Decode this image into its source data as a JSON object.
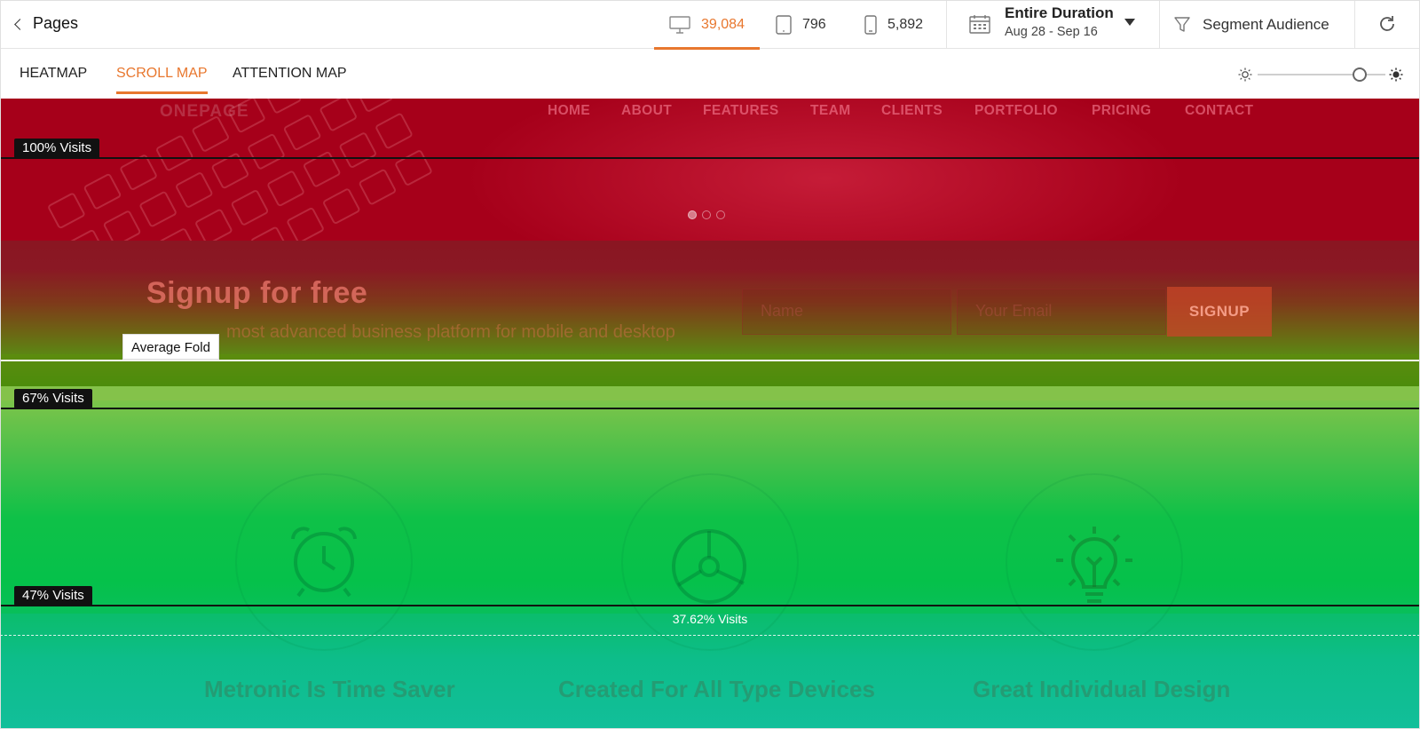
{
  "header": {
    "back_label": "Pages",
    "devices": {
      "desktop": {
        "count": "39,084",
        "icon": "desktop-icon"
      },
      "tablet": {
        "count": "796",
        "icon": "tablet-icon"
      },
      "mobile": {
        "count": "5,892",
        "icon": "mobile-icon"
      }
    },
    "date": {
      "title": "Entire Duration",
      "range": "Aug 28 - Sep 16"
    },
    "segment_label": "Segment Audience"
  },
  "tabs": [
    {
      "label": "HEATMAP",
      "active": false
    },
    {
      "label": "SCROLL MAP",
      "active": true
    },
    {
      "label": "ATTENTION MAP",
      "active": false
    }
  ],
  "brightness_slider": {
    "value": 0.8
  },
  "accent_color": "#e8772e",
  "site": {
    "logo": "ONEPAGE",
    "nav": [
      "HOME",
      "ABOUT",
      "FEATURES",
      "TEAM",
      "CLIENTS",
      "PORTFOLIO",
      "PRICING",
      "CONTACT"
    ],
    "signup": {
      "title": "Signup for free",
      "subtitle": "most advanced business platform for mobile and desktop",
      "name_placeholder": "Name",
      "email_placeholder": "Your Email",
      "button": "SIGNUP"
    },
    "features": [
      "Metronic Is Time Saver",
      "Created For All Type Devices",
      "Great Individual Design"
    ]
  },
  "scroll_markers": {
    "visits_100": "100% Visits",
    "visits_67": "67% Visits",
    "visits_47": "47% Visits",
    "average_fold": "Average Fold",
    "visits_avg": "37.62% Visits"
  }
}
